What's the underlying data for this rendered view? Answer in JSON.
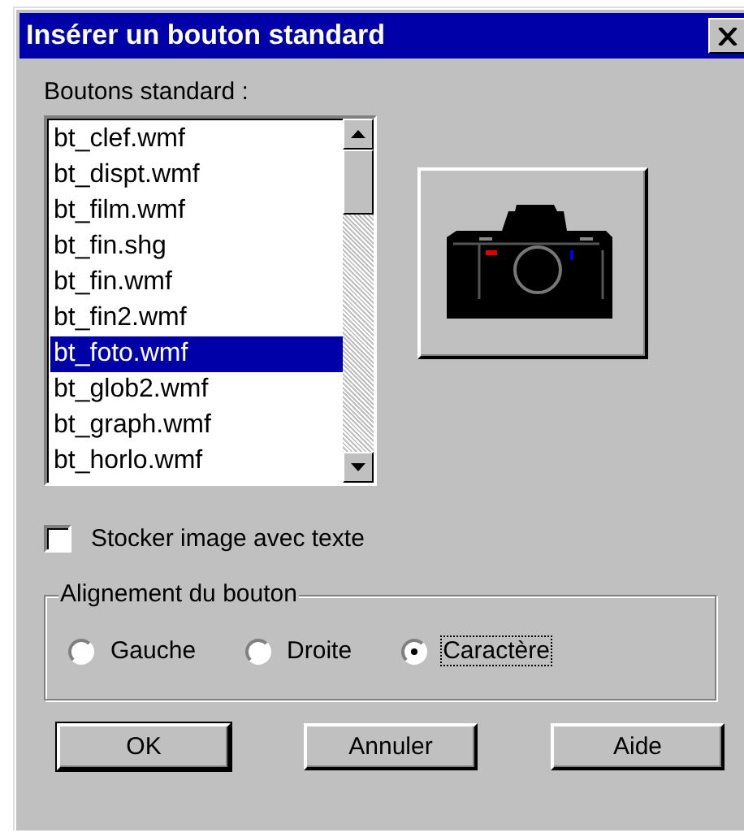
{
  "window": {
    "title": "Insérer un bouton standard"
  },
  "list_label": "Boutons standard :",
  "files": [
    {
      "name": "bt_clef.wmf",
      "selected": false
    },
    {
      "name": "bt_dispt.wmf",
      "selected": false
    },
    {
      "name": "bt_film.wmf",
      "selected": false
    },
    {
      "name": "bt_fin.shg",
      "selected": false
    },
    {
      "name": "bt_fin.wmf",
      "selected": false
    },
    {
      "name": "bt_fin2.wmf",
      "selected": false
    },
    {
      "name": "bt_foto.wmf",
      "selected": true
    },
    {
      "name": "bt_glob2.wmf",
      "selected": false
    },
    {
      "name": "bt_graph.wmf",
      "selected": false
    },
    {
      "name": "bt_horlo.wmf",
      "selected": false
    }
  ],
  "store_with_text": {
    "label": "Stocker image avec texte",
    "checked": false
  },
  "alignment": {
    "title": "Alignement du bouton",
    "options": [
      {
        "label": "Gauche",
        "selected": false,
        "focused": false
      },
      {
        "label": "Droite",
        "selected": false,
        "focused": false
      },
      {
        "label": "Caractère",
        "selected": true,
        "focused": true
      }
    ]
  },
  "buttons": [
    {
      "label": "OK",
      "default": true
    },
    {
      "label": "Annuler",
      "default": false
    },
    {
      "label": "Aide",
      "default": false
    }
  ]
}
